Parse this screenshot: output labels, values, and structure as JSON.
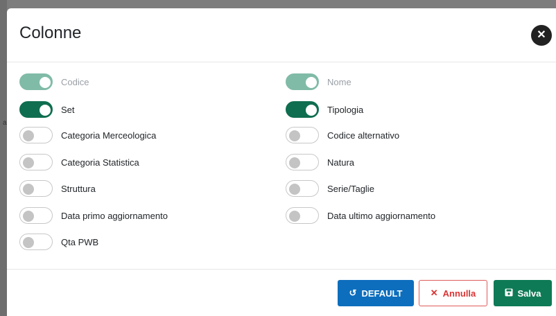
{
  "dialog": {
    "title": "Colonne",
    "close_icon": "✕"
  },
  "columns": {
    "left": [
      {
        "label": "Codice",
        "state": "disabled-on"
      },
      {
        "label": "Set",
        "state": "on"
      },
      {
        "label": "Categoria Merceologica",
        "state": "off"
      },
      {
        "label": "Categoria Statistica",
        "state": "off"
      },
      {
        "label": "Struttura",
        "state": "off"
      },
      {
        "label": "Data primo aggiornamento",
        "state": "off"
      },
      {
        "label": "Qta PWB",
        "state": "off"
      }
    ],
    "right": [
      {
        "label": "Nome",
        "state": "disabled-on"
      },
      {
        "label": "Tipologia",
        "state": "on"
      },
      {
        "label": "Codice alternativo",
        "state": "off"
      },
      {
        "label": "Natura",
        "state": "off"
      },
      {
        "label": "Serie/Taglie",
        "state": "off"
      },
      {
        "label": "Data ultimo aggiornamento",
        "state": "off"
      }
    ]
  },
  "footer": {
    "default_label": "DEFAULT",
    "default_icon": "reset-icon",
    "cancel_label": "Annulla",
    "cancel_icon": "close-icon",
    "save_label": "Salva",
    "save_icon": "save-icon"
  },
  "colors": {
    "primary_green": "#0f6e50",
    "disabled_green": "#80bba8",
    "default_blue": "#0d6ebd",
    "cancel_red": "#d93535"
  }
}
